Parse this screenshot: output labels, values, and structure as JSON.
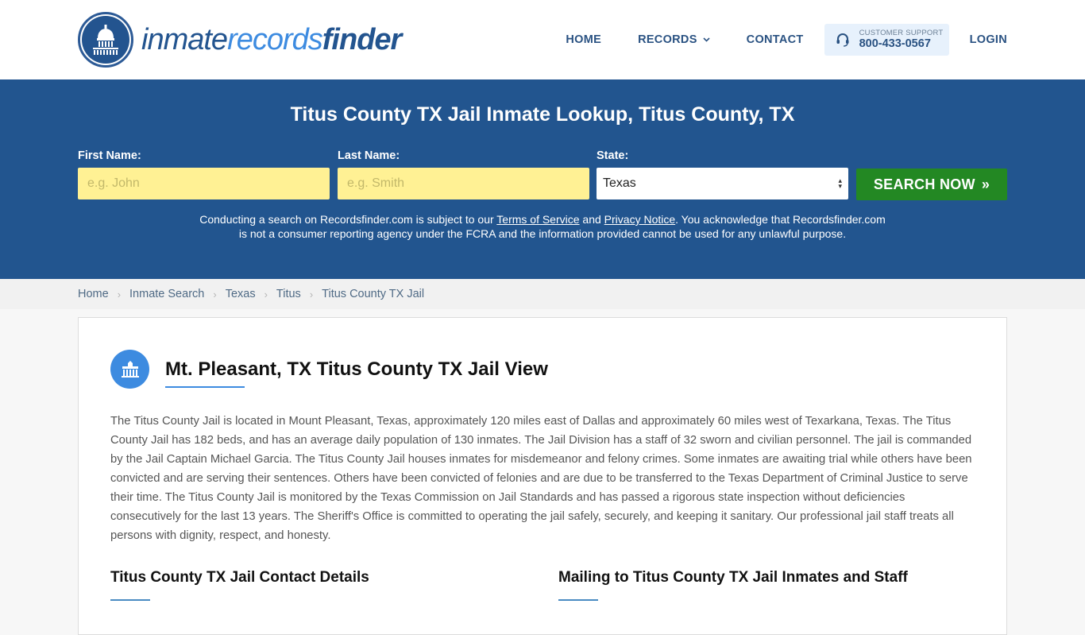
{
  "brand": {
    "logo_part1": "inmate",
    "logo_part2": "records",
    "logo_part3": "finder",
    "primary_color": "#22558f",
    "accent_color": "#3d8be0",
    "cta_color": "#238823",
    "input_highlight": "#fff194"
  },
  "nav": {
    "home": "HOME",
    "records": "RECORDS",
    "contact": "CONTACT",
    "support_label": "CUSTOMER SUPPORT",
    "support_phone": "800-433-0567",
    "login": "LOGIN"
  },
  "hero": {
    "title": "Titus County TX Jail Inmate Lookup, Titus County, TX",
    "first_name_label": "First Name:",
    "first_name_placeholder": "e.g. John",
    "first_name_value": "",
    "last_name_label": "Last Name:",
    "last_name_placeholder": "e.g. Smith",
    "last_name_value": "",
    "state_label": "State:",
    "state_value": "Texas",
    "search_button": "SEARCH NOW",
    "disclaimer_before": "Conducting a search on Recordsfinder.com is subject to our ",
    "terms_link": "Terms of Service",
    "disclaimer_and": " and ",
    "privacy_link": "Privacy Notice",
    "disclaimer_after": ". You acknowledge that Recordsfinder.com is not a consumer reporting agency under the FCRA and the information provided cannot be used for any unlawful purpose."
  },
  "breadcrumb": [
    {
      "label": "Home"
    },
    {
      "label": "Inmate Search"
    },
    {
      "label": "Texas"
    },
    {
      "label": "Titus"
    },
    {
      "label": "Titus County TX Jail"
    }
  ],
  "content": {
    "title": "Mt. Pleasant, TX Titus County TX Jail View",
    "description": "The Titus County Jail is located in Mount Pleasant, Texas, approximately 120 miles east of Dallas and approximately 60 miles west of Texarkana, Texas. The Titus County Jail has 182 beds, and has an average daily population of 130 inmates. The Jail Division has a staff of 32 sworn and civilian personnel. The jail is commanded by the Jail Captain Michael Garcia. The Titus County Jail houses inmates for misdemeanor and felony crimes. Some inmates are awaiting trial while others have been convicted and are serving their sentences. Others have been convicted of felonies and are due to be transferred to the Texas Department of Criminal Justice to serve their time. The Titus County Jail is monitored by the Texas Commission on Jail Standards and has passed a rigorous state inspection without deficiencies consecutively for the last 13 years. The Sheriff's Office is committed to operating the jail safely, securely, and keeping it sanitary. Our professional jail staff treats all persons with dignity, respect, and honesty.",
    "contact_heading": "Titus County TX Jail Contact Details",
    "mailing_heading": "Mailing to Titus County TX Jail Inmates and Staff"
  }
}
